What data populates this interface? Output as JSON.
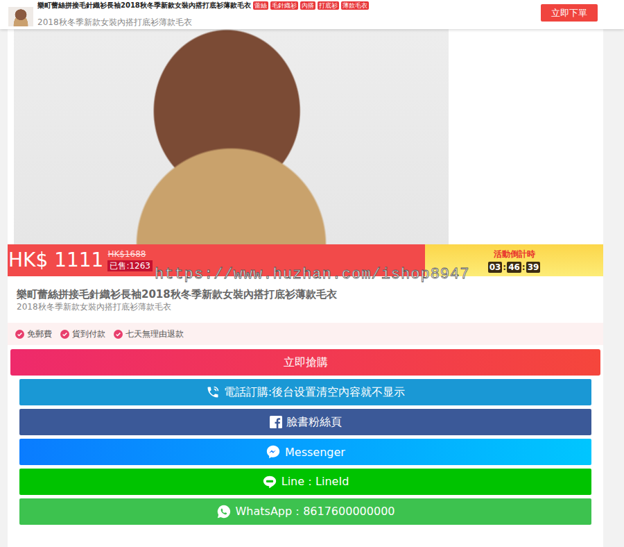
{
  "header": {
    "title": "樂町蕾絲拼接毛針織衫長袖2018秋冬季新款女裝內搭打底衫薄款毛衣",
    "tags": [
      "蕾絲",
      "毛針織衫",
      "內搭",
      "打底衫",
      "薄款毛衣"
    ],
    "subtitle": "2018秋冬季新款女裝內搭打底衫薄款毛衣",
    "order_button": "立即下單"
  },
  "price": {
    "current": "HK$ 1111",
    "original": "HK$1688",
    "sold": "已售:1263"
  },
  "countdown": {
    "label": "活動倒計時",
    "hours": "03",
    "minutes": "46",
    "seconds": "39",
    "separator": ":"
  },
  "watermark": "https://www.huzhan.com/ishop8947",
  "product": {
    "title": "樂町蕾絲拼接毛針織衫長袖2018秋冬季新款女裝內搭打底衫薄款毛衣",
    "subtitle": "2018秋冬季新款女裝內搭打底衫薄款毛衣"
  },
  "features": [
    "免郵費",
    "貨到付款",
    "七天無理由退款"
  ],
  "buy_button": "立即搶購",
  "contact_buttons": [
    {
      "label": "電話訂購:後台设置清空內容就不显示",
      "kind": "phone",
      "color": "#1a98d5"
    },
    {
      "label": "臉書粉絲頁",
      "kind": "facebook",
      "color": "#3b5998"
    },
    {
      "label": "Messenger",
      "kind": "messenger",
      "color": "#0a7cff"
    },
    {
      "label": "Line：LineId",
      "kind": "line",
      "color": "#00c300"
    },
    {
      "label": "WhatsApp：8617600000000",
      "kind": "whatsapp",
      "color": "#3dc24f"
    }
  ]
}
